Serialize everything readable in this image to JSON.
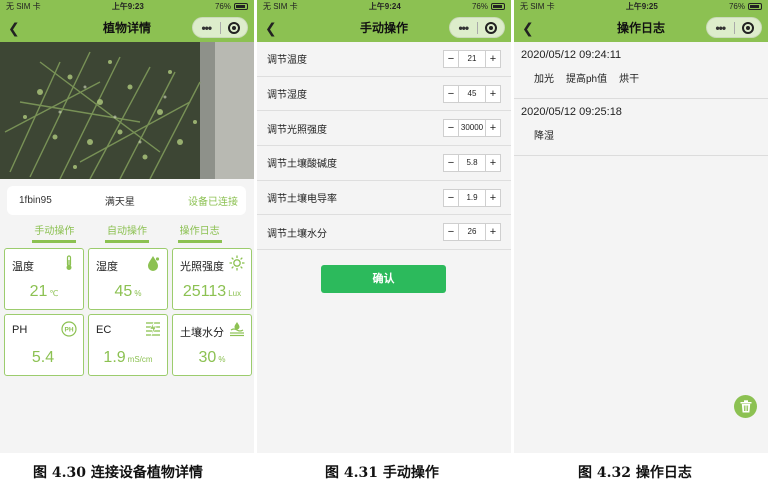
{
  "status_bar": {
    "carrier": "无 SIM 卡",
    "battery": "76%",
    "times": [
      "上午9:23",
      "上午9:24",
      "上午9:25"
    ]
  },
  "colors": {
    "accent": "#8cc152",
    "confirm": "#2cba5c"
  },
  "screen1": {
    "title": "植物详情",
    "device": {
      "id": "1fbin95",
      "plant": "满天星",
      "status": "设备已连接"
    },
    "tabs": [
      "手动操作",
      "自动操作",
      "操作日志"
    ],
    "sensors": [
      {
        "label": "温度",
        "value": "21",
        "unit": "℃",
        "icon": "thermometer-icon"
      },
      {
        "label": "湿度",
        "value": "45",
        "unit": "%",
        "icon": "water-drop-icon"
      },
      {
        "label": "光照强度",
        "value": "25113",
        "unit": "Lux",
        "icon": "sun-icon"
      },
      {
        "label": "PH",
        "value": "5.4",
        "unit": "",
        "icon": "ph-icon"
      },
      {
        "label": "EC",
        "value": "1.9",
        "unit": "mS/cm",
        "icon": "ec-icon"
      },
      {
        "label": "土壤水分",
        "value": "30",
        "unit": "%",
        "icon": "soil-moisture-icon"
      }
    ]
  },
  "screen2": {
    "title": "手动操作",
    "controls": [
      {
        "label": "调节温度",
        "value": "21"
      },
      {
        "label": "调节湿度",
        "value": "45"
      },
      {
        "label": "调节光照强度",
        "value": "30000"
      },
      {
        "label": "调节土壤酸碱度",
        "value": "5.8"
      },
      {
        "label": "调节土壤电导率",
        "value": "1.9"
      },
      {
        "label": "调节土壤水分",
        "value": "26"
      }
    ],
    "confirm_label": "确认"
  },
  "screen3": {
    "title": "操作日志",
    "logs": [
      {
        "time": "2020/05/12 09:24:11",
        "items": [
          "加光",
          "提高ph值",
          "烘干"
        ]
      },
      {
        "time": "2020/05/12 09:25:18",
        "items": [
          "降湿"
        ]
      }
    ]
  },
  "captions": [
    "图 4.30 连接设备植物详情",
    "图 4.31 手动操作",
    "图 4.32 操作日志"
  ]
}
